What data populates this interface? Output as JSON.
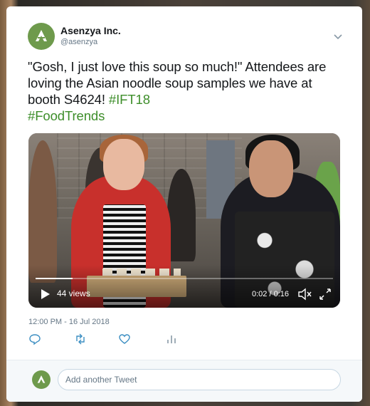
{
  "account": {
    "name": "Asenzya Inc.",
    "handle": "@asenzya",
    "brand_color": "#6e9a4c"
  },
  "tweet": {
    "text_before": "\"Gosh, I just love this soup so much!\" Attendees are loving the Asian noodle soup samples we have at booth S4624! ",
    "hashtag_1": "#IFT18",
    "hashtag_2": "#FoodTrends",
    "hashtag_color": "#3e8e2b",
    "timestamp": "12:00 PM - 16 Jul 2018"
  },
  "video": {
    "views": "44 views",
    "time": "0:02 / 0:16",
    "progress_fraction": 0.125
  },
  "actions": {
    "icons": [
      "reply-icon",
      "retweet-icon",
      "like-icon",
      "analytics-icon"
    ]
  },
  "reply": {
    "placeholder": "Add another Tweet"
  }
}
